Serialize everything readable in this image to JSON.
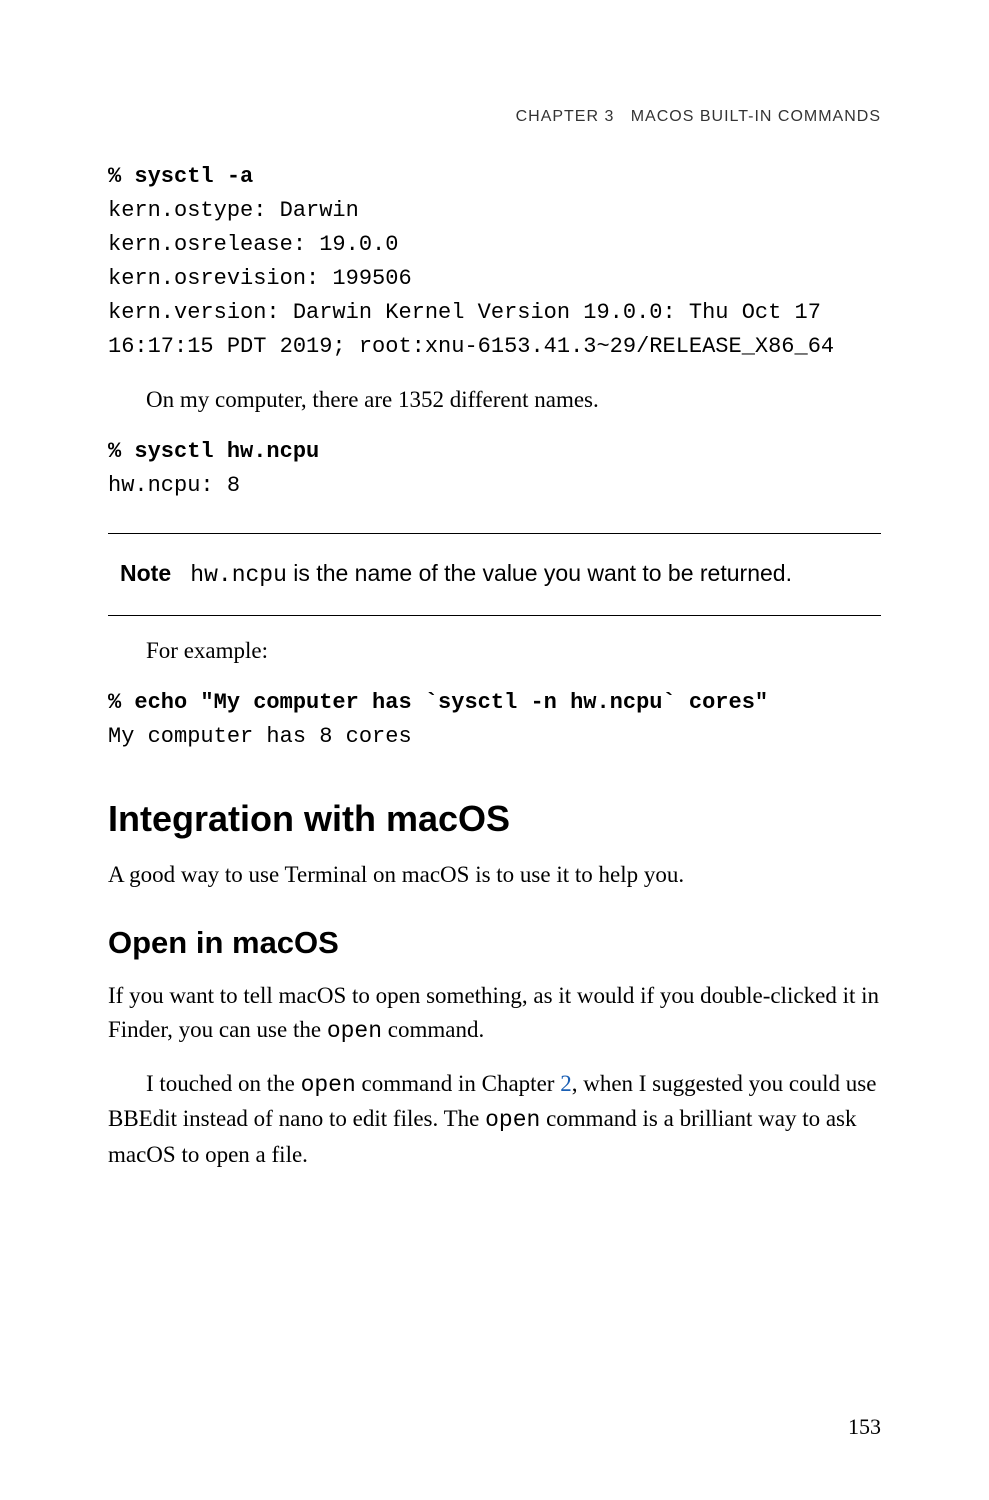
{
  "header": {
    "chapter_label": "CHAPTER 3",
    "chapter_title": "MACOS BUILT-IN COMMANDS"
  },
  "code1": {
    "cmd": "% sysctl -a",
    "out_l1": "kern.ostype: Darwin",
    "out_l2": "kern.osrelease: 19.0.0",
    "out_l3": "kern.osrevision: 199506",
    "out_l4": "kern.version: Darwin Kernel Version 19.0.0: Thu Oct 17 16:17:15 PDT 2019; root:xnu-6153.41.3~29/RELEASE_X86_64"
  },
  "p1": "On my computer, there are 1352 different names.",
  "code2": {
    "cmd": "% sysctl hw.ncpu",
    "out": "hw.ncpu: 8"
  },
  "note": {
    "label": "Note",
    "code": "hw.ncpu",
    "text_after": " is the name of the value you want to be returned."
  },
  "p2": "For example:",
  "code3": {
    "cmd": "% echo \"My computer has `sysctl -n hw.ncpu` cores\"",
    "out": "My computer has 8 cores"
  },
  "h1": "Integration with macOS",
  "p3": "A good way to use Terminal on macOS is to use it to help you.",
  "h2": "Open in macOS",
  "p4_pre": "If you want to tell macOS to open something, as it would if you double-clicked it in Finder, you can use the ",
  "p4_code": "open",
  "p4_post": " command.",
  "p5_s1": "I touched on the ",
  "p5_code1": "open",
  "p5_s2": " command in Chapter ",
  "p5_link": "2",
  "p5_s3": ", when I suggested you could use BBEdit instead of nano to edit files. The ",
  "p5_code2": "open",
  "p5_s4": " command is a brilliant way to ask macOS to open a file.",
  "page_number": "153"
}
